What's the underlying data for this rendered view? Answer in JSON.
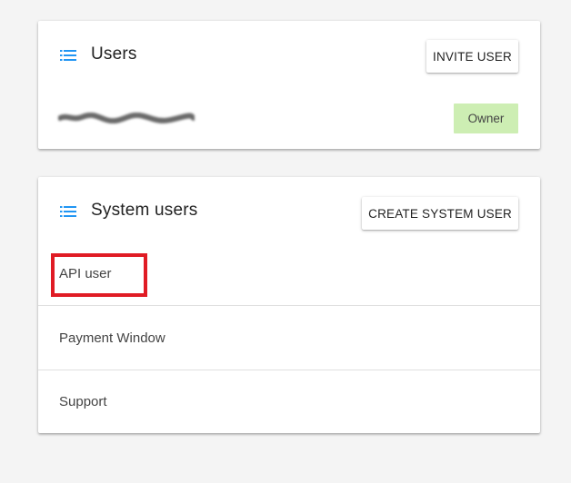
{
  "users_card": {
    "title": "Users",
    "invite_button": "INVITE USER",
    "members": [
      {
        "email": "",
        "role": "Owner"
      }
    ]
  },
  "system_users_card": {
    "title": "System users",
    "create_button": "CREATE SYSTEM USER",
    "items": [
      {
        "label": "API user",
        "highlighted": true
      },
      {
        "label": "Payment Window"
      },
      {
        "label": "Support"
      }
    ]
  },
  "colors": {
    "accent": "#2196f3",
    "owner_badge": "#cdeeb3",
    "highlight": "#e01b24",
    "background": "#f4f4f4"
  },
  "icons": {
    "section": "list-icon"
  }
}
